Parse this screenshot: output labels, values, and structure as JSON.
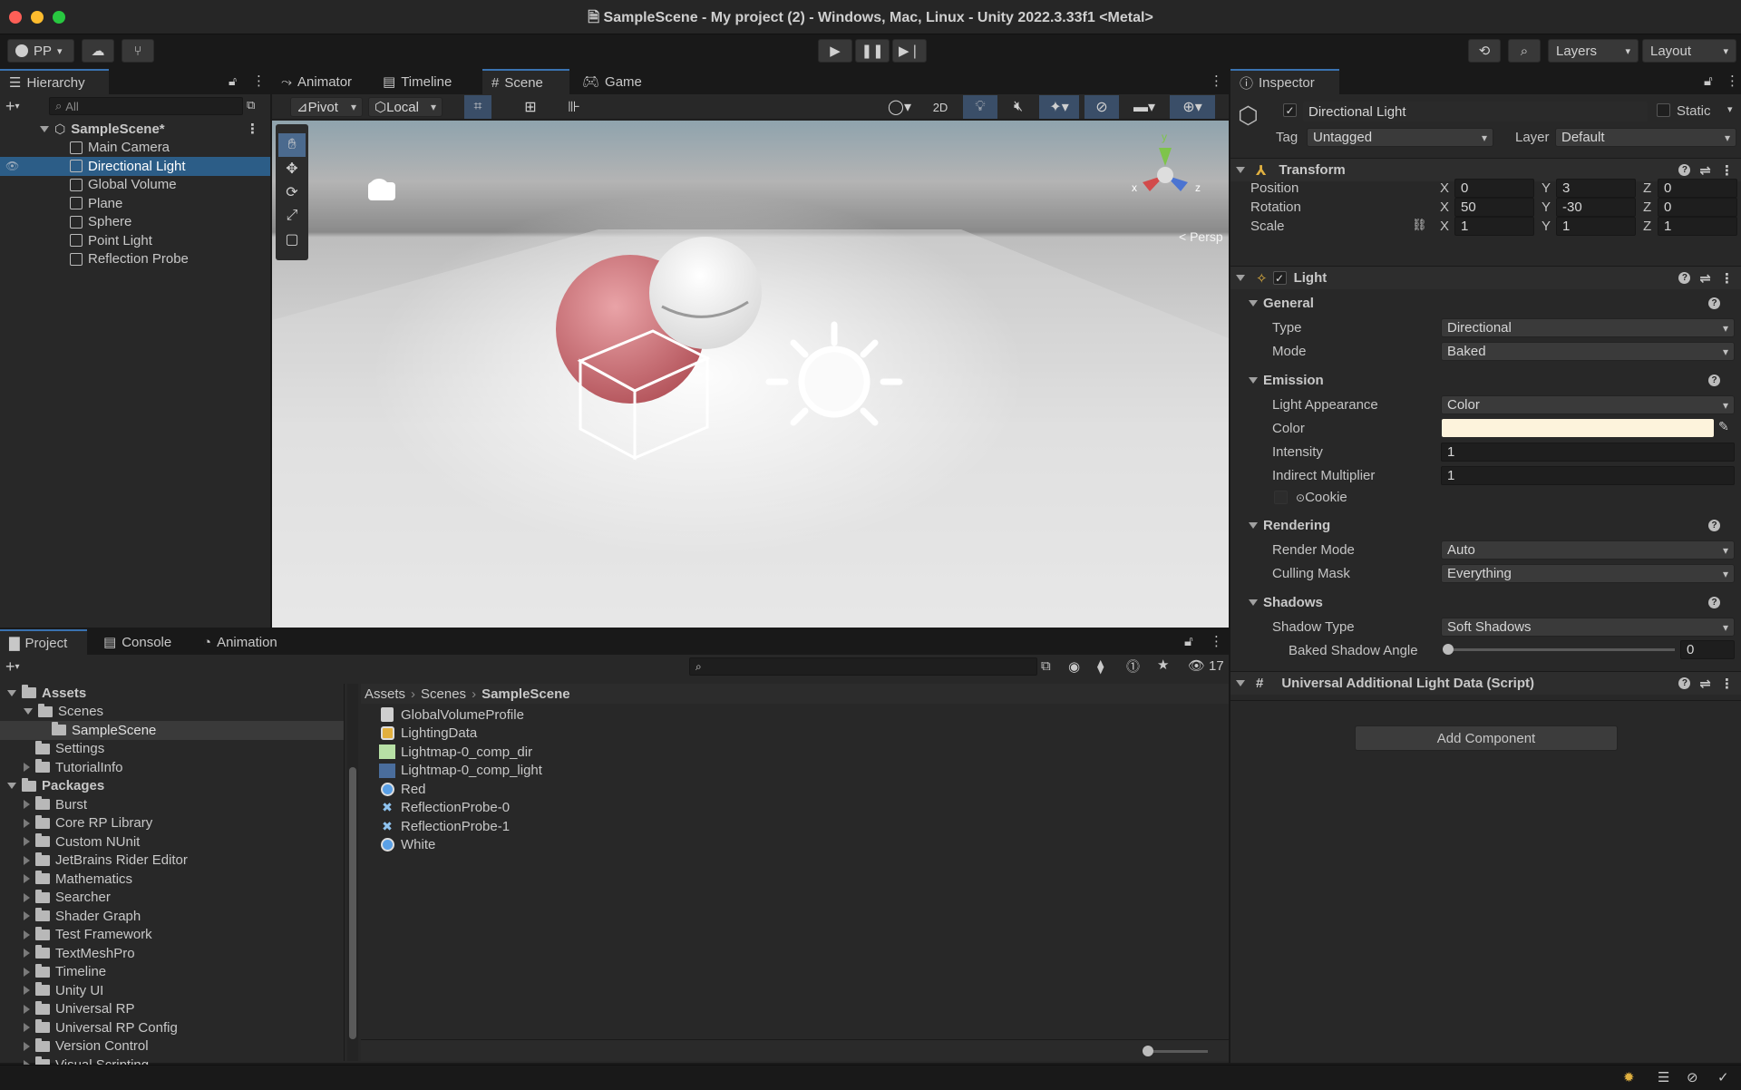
{
  "window": {
    "title": "SampleScene - My project (2) - Windows, Mac, Linux - Unity 2022.3.33f1 <Metal>"
  },
  "toolbar": {
    "account": "PP",
    "layers": "Layers",
    "layout": "Layout"
  },
  "hierarchy": {
    "tab": "Hierarchy",
    "search_placeholder": "All",
    "scene": "SampleScene*",
    "items": [
      "Main Camera",
      "Directional Light",
      "Global Volume",
      "Plane",
      "Sphere",
      "Point Light",
      "Reflection Probe"
    ]
  },
  "scene_tabs": [
    "Animator",
    "Timeline",
    "Scene",
    "Game"
  ],
  "scene_toolbar": {
    "pivot": "Pivot",
    "local": "Local",
    "mode_2d": "2D"
  },
  "scene_view": {
    "projection": "Persp",
    "axis_x": "x",
    "axis_y": "y",
    "axis_z": "z"
  },
  "project": {
    "tabs": [
      "Project",
      "Console",
      "Animation"
    ],
    "visible_count": "17",
    "tree": [
      {
        "label": "Assets",
        "level": 0,
        "expanded": true,
        "bold": true
      },
      {
        "label": "Scenes",
        "level": 1,
        "expanded": true
      },
      {
        "label": "SampleScene",
        "level": 2,
        "selected": true
      },
      {
        "label": "Settings",
        "level": 1
      },
      {
        "label": "TutorialInfo",
        "level": 1,
        "collapsed": true
      },
      {
        "label": "Packages",
        "level": 0,
        "expanded": true,
        "bold": true
      },
      {
        "label": "Burst",
        "level": 1,
        "collapsed": true
      },
      {
        "label": "Core RP Library",
        "level": 1,
        "collapsed": true
      },
      {
        "label": "Custom NUnit",
        "level": 1,
        "collapsed": true
      },
      {
        "label": "JetBrains Rider Editor",
        "level": 1,
        "collapsed": true
      },
      {
        "label": "Mathematics",
        "level": 1,
        "collapsed": true
      },
      {
        "label": "Searcher",
        "level": 1,
        "collapsed": true
      },
      {
        "label": "Shader Graph",
        "level": 1,
        "collapsed": true
      },
      {
        "label": "Test Framework",
        "level": 1,
        "collapsed": true
      },
      {
        "label": "TextMeshPro",
        "level": 1,
        "collapsed": true
      },
      {
        "label": "Timeline",
        "level": 1,
        "collapsed": true
      },
      {
        "label": "Unity UI",
        "level": 1,
        "collapsed": true
      },
      {
        "label": "Universal RP",
        "level": 1,
        "collapsed": true
      },
      {
        "label": "Universal RP Config",
        "level": 1,
        "collapsed": true
      },
      {
        "label": "Version Control",
        "level": 1,
        "collapsed": true
      },
      {
        "label": "Visual Scripting",
        "level": 1,
        "collapsed": true
      }
    ],
    "breadcrumb": [
      "Assets",
      "Scenes",
      "SampleScene"
    ],
    "files": [
      {
        "label": "GlobalVolumeProfile",
        "icon": "profile-icon"
      },
      {
        "label": "LightingData",
        "icon": "lighting-data-icon"
      },
      {
        "label": "Lightmap-0_comp_dir",
        "icon": "texture-icon",
        "color": "#b7e0a5"
      },
      {
        "label": "Lightmap-0_comp_light",
        "icon": "texture-icon",
        "color": "#4a6d9c"
      },
      {
        "label": "Red",
        "icon": "material-icon"
      },
      {
        "label": "ReflectionProbe-0",
        "icon": "probe-icon"
      },
      {
        "label": "ReflectionProbe-1",
        "icon": "probe-icon"
      },
      {
        "label": "White",
        "icon": "material-icon"
      }
    ]
  },
  "inspector": {
    "tab": "Inspector",
    "object_name": "Directional Light",
    "static": "Static",
    "tag_label": "Tag",
    "tag": "Untagged",
    "layer_label": "Layer",
    "layer": "Default",
    "transform": {
      "title": "Transform",
      "position_label": "Position",
      "rotation_label": "Rotation",
      "scale_label": "Scale",
      "position": [
        "0",
        "3",
        "0"
      ],
      "rotation": [
        "50",
        "-30",
        "0"
      ],
      "scale": [
        "1",
        "1",
        "1"
      ],
      "axes": [
        "X",
        "Y",
        "Z"
      ]
    },
    "light": {
      "title": "Light",
      "general": "General",
      "type_label": "Type",
      "type": "Directional",
      "mode_label": "Mode",
      "mode": "Baked",
      "emission": "Emission",
      "appearance_label": "Light Appearance",
      "appearance": "Color",
      "color_label": "Color",
      "color": "#fdf3dc",
      "intensity_label": "Intensity",
      "intensity": "1",
      "indirect_label": "Indirect Multiplier",
      "indirect": "1",
      "cookie_label": "Cookie",
      "rendering": "Rendering",
      "render_mode_label": "Render Mode",
      "render_mode": "Auto",
      "culling_label": "Culling Mask",
      "culling": "Everything",
      "shadows": "Shadows",
      "shadow_type_label": "Shadow Type",
      "shadow_type": "Soft Shadows",
      "baked_angle_label": "Baked Shadow Angle",
      "baked_angle": "0"
    },
    "script": {
      "title": "Universal Additional Light Data (Script)"
    },
    "add_component": "Add Component"
  },
  "colors": {
    "accent": "#2c5d87",
    "panel": "#282828"
  }
}
